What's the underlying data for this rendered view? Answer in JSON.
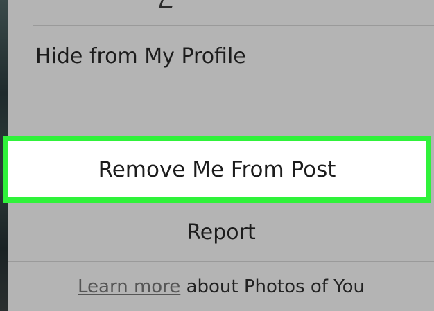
{
  "action_sheet": {
    "items": [
      {
        "label": "Hide from My Profile"
      },
      {
        "label": "Remove Me From Post"
      },
      {
        "label": "Report"
      }
    ],
    "footer": {
      "link_text": "Learn more",
      "rest_text": "about Photos of You"
    }
  },
  "colors": {
    "sheet_background": "#b4b4b4",
    "highlight_border": "#2ff23a",
    "highlight_fill": "#ffffff"
  }
}
